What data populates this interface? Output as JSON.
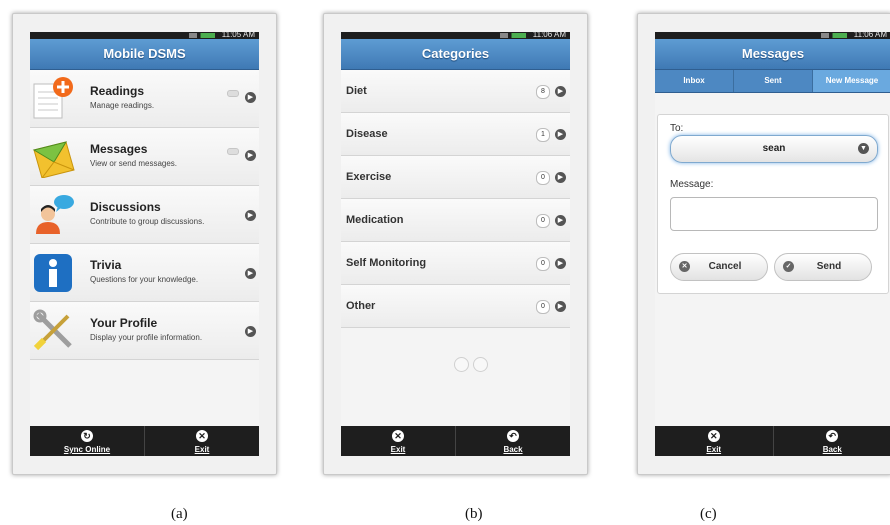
{
  "panel_a": {
    "header_title": "Mobile DSMS",
    "menu": [
      {
        "icon": "readings-add-icon",
        "title": "Readings",
        "subtitle": "Manage readings."
      },
      {
        "icon": "messages-envelope-icon",
        "title": "Messages",
        "subtitle": "View or send messages."
      },
      {
        "icon": "discussions-person-icon",
        "title": "Discussions",
        "subtitle": "Contribute to group discussions."
      },
      {
        "icon": "trivia-info-icon",
        "title": "Trivia",
        "subtitle": "Questions for your knowledge."
      },
      {
        "icon": "profile-tools-icon",
        "title": "Your Profile",
        "subtitle": "Display your profile information."
      }
    ],
    "footer": [
      {
        "icon": "sync-icon",
        "label": "Sync Online"
      },
      {
        "icon": "close-icon",
        "label": "Exit"
      }
    ],
    "caption": "(a)"
  },
  "panel_b": {
    "header_title": "Categories",
    "categories": [
      {
        "label": "Diet",
        "count": "8"
      },
      {
        "label": "Disease",
        "count": "1"
      },
      {
        "label": "Exercise",
        "count": "0"
      },
      {
        "label": "Medication",
        "count": "0"
      },
      {
        "label": "Self Monitoring",
        "count": "0"
      },
      {
        "label": "Other",
        "count": "0"
      }
    ],
    "footer": [
      {
        "icon": "close-icon",
        "label": "Exit"
      },
      {
        "icon": "back-icon",
        "label": "Back"
      }
    ],
    "caption": "(b)"
  },
  "panel_c": {
    "header_title": "Messages",
    "tabs": [
      "Inbox",
      "Sent",
      "New Message"
    ],
    "active_tab": "New Message",
    "to_label": "To:",
    "to_value": "sean",
    "message_label": "Message:",
    "message_value": "",
    "cancel_label": "Cancel",
    "send_label": "Send",
    "footer": [
      {
        "icon": "close-icon",
        "label": "Exit"
      },
      {
        "icon": "back-icon",
        "label": "Back"
      }
    ],
    "caption": "(c)"
  },
  "colors": {
    "header_blue": "#4a86c3",
    "footer_black": "#1e1e1e",
    "tab_active": "#6aa9df"
  }
}
